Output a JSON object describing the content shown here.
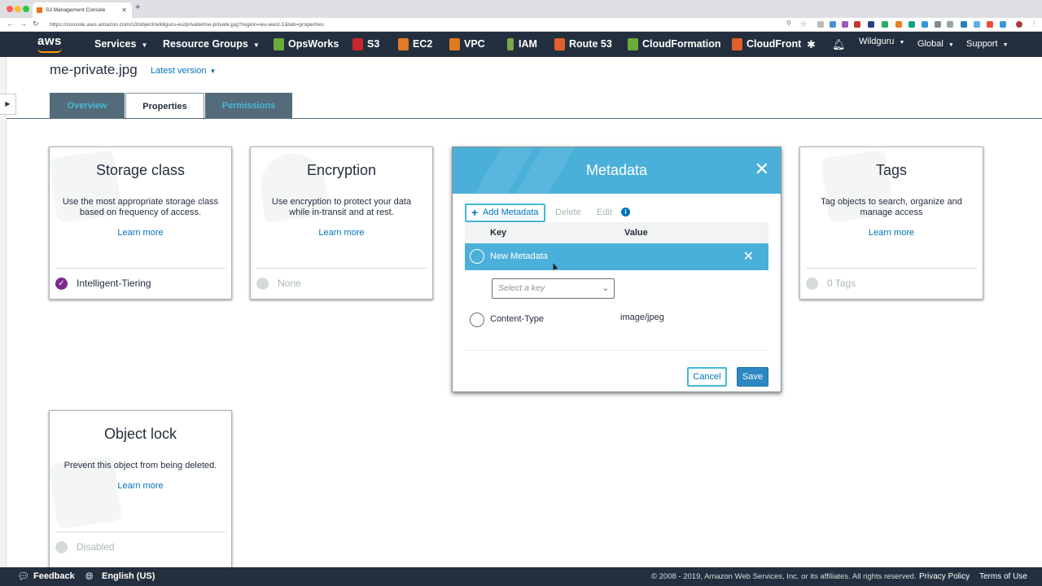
{
  "browser": {
    "tab_title": "S3 Management Console",
    "url": "https://console.aws.amazon.com/s3/object/wildguru-eu/private/me-private.jpg?region=eu-west-1&tab=properties"
  },
  "aws_nav": {
    "logo": "aws",
    "services": "Services",
    "resource_groups": "Resource Groups",
    "shortcuts": [
      {
        "label": "OpsWorks",
        "color": "#6aaa3a"
      },
      {
        "label": "S3",
        "color": "#c7262a"
      },
      {
        "label": "EC2",
        "color": "#e07b24"
      },
      {
        "label": "VPC",
        "color": "#e07b24"
      },
      {
        "label": "IAM",
        "color": "#7ba742"
      },
      {
        "label": "Route 53",
        "color": "#e0602a"
      },
      {
        "label": "CloudFormation",
        "color": "#6aaa3a"
      },
      {
        "label": "CloudFront",
        "color": "#e0602a"
      }
    ],
    "account": "Wildguru",
    "region": "Global",
    "support": "Support"
  },
  "object": {
    "name": "me-private.jpg",
    "version": "Latest version"
  },
  "tabs": [
    "Overview",
    "Properties",
    "Permissions"
  ],
  "cards": {
    "storage": {
      "title": "Storage class",
      "desc": "Use the most appropriate storage class based on frequency of access.",
      "learn": "Learn more",
      "status": "Intelligent-Tiering"
    },
    "encryption": {
      "title": "Encryption",
      "desc": "Use encryption to protect your data while in-transit and at rest.",
      "learn": "Learn more",
      "status": "None"
    },
    "tags": {
      "title": "Tags",
      "desc": "Tag objects to search, organize and manage access",
      "learn": "Learn more",
      "status": "0 Tags"
    },
    "lock": {
      "title": "Object lock",
      "desc": "Prevent this object from being deleted.",
      "learn": "Learn more",
      "status": "Disabled"
    }
  },
  "modal": {
    "title": "Metadata",
    "add_button": "Add Metadata",
    "delete": "Delete",
    "edit": "Edit",
    "col_key": "Key",
    "col_value": "Value",
    "new_row": "New Metadata",
    "key_placeholder": "Select a key",
    "row_key": "Content-Type",
    "row_value": "image/jpeg",
    "cancel": "Cancel",
    "save": "Save"
  },
  "footer": {
    "feedback": "Feedback",
    "language": "English (US)",
    "copyright": "© 2008 - 2019, Amazon Web Services, Inc. or its affiliates. All rights reserved.",
    "privacy": "Privacy Policy",
    "terms": "Terms of Use"
  }
}
